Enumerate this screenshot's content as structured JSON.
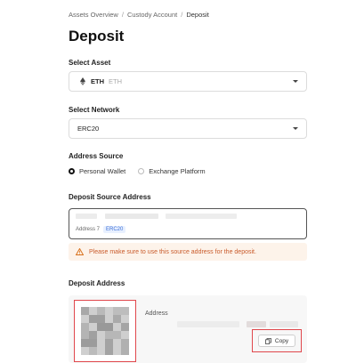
{
  "breadcrumb": [
    "Assets Overview",
    "Custody Account",
    "Deposit"
  ],
  "breadcrumb_sep": "/",
  "page_title": "Deposit",
  "select_asset": {
    "label": "Select Asset",
    "code": "ETH",
    "sub": "ETH",
    "icon": "ethereum-icon"
  },
  "select_network": {
    "label": "Select Network",
    "value": "ERC20"
  },
  "address_source": {
    "label": "Address Source",
    "options": [
      "Personal Wallet",
      "Exchange Platform"
    ],
    "selected": "Personal Wallet"
  },
  "deposit_source": {
    "label": "Deposit Source Address",
    "meta_label": "Address 7",
    "tag": "ERC20"
  },
  "warning": {
    "text": "Please make sure to use this source address for the deposit.",
    "icon": "warning-triangle-icon",
    "color": "#c95b2b"
  },
  "deposit_address": {
    "label": "Deposit Address",
    "address_title": "Address",
    "copy_label": "Copy",
    "copy_icon": "copy-icon"
  },
  "colors": {
    "highlight": "#e0474c",
    "tag": "#3b6fd6"
  }
}
